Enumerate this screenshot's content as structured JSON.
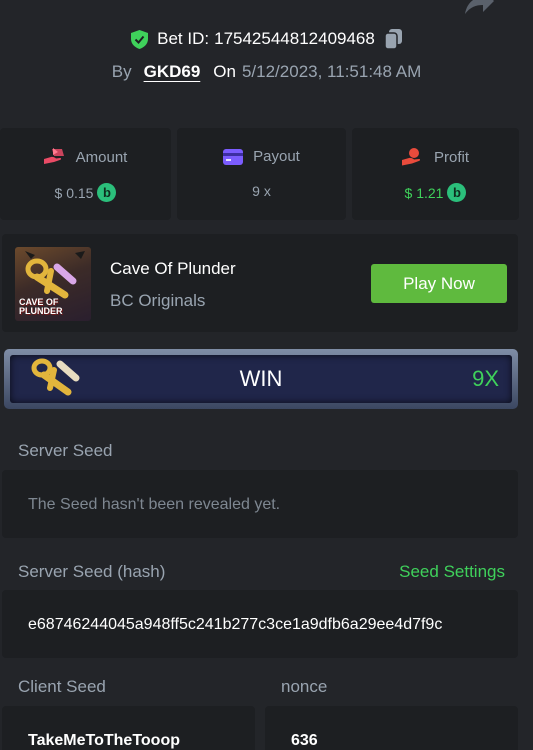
{
  "header": {
    "bet_id_label": "Bet ID:",
    "bet_id": "17542544812409468",
    "by_label": "By",
    "username": "GKD69",
    "on_label": "On",
    "datetime": "5/12/2023, 11:51:48 AM"
  },
  "stats": {
    "amount": {
      "label": "Amount",
      "value": "$ 0.15",
      "icon": "hand-money-icon"
    },
    "payout": {
      "label": "Payout",
      "value": "9 x",
      "icon": "card-icon"
    },
    "profit": {
      "label": "Profit",
      "value": "$ 1.21",
      "icon": "hand-coin-icon"
    },
    "coin_symbol": "b"
  },
  "game": {
    "title": "Cave Of Plunder",
    "subtitle": "BC Originals",
    "thumb_text_line1": "CAVE OF",
    "thumb_text_line2": "PLUNDER",
    "play_label": "Play Now"
  },
  "result": {
    "outcome": "WIN",
    "multiplier": "9X"
  },
  "seeds": {
    "server_seed_label": "Server Seed",
    "server_seed_value": "The Seed hasn't been revealed yet.",
    "server_hash_label": "Server Seed (hash)",
    "seed_settings_label": "Seed Settings",
    "server_hash_value": "e68746244045a948ff5c241b277c3ce1a9dfb6a29ee4d7f9c",
    "client_seed_label": "Client Seed",
    "client_seed_value": "TakeMeToTheTooop",
    "nonce_label": "nonce",
    "nonce_value": "636"
  },
  "colors": {
    "background": "#232529",
    "card": "#1d1f22",
    "accent_green": "#3fd15b",
    "button_green": "#5fba3e",
    "muted_text": "#99a4b0",
    "coin": "#2bbf7b"
  }
}
